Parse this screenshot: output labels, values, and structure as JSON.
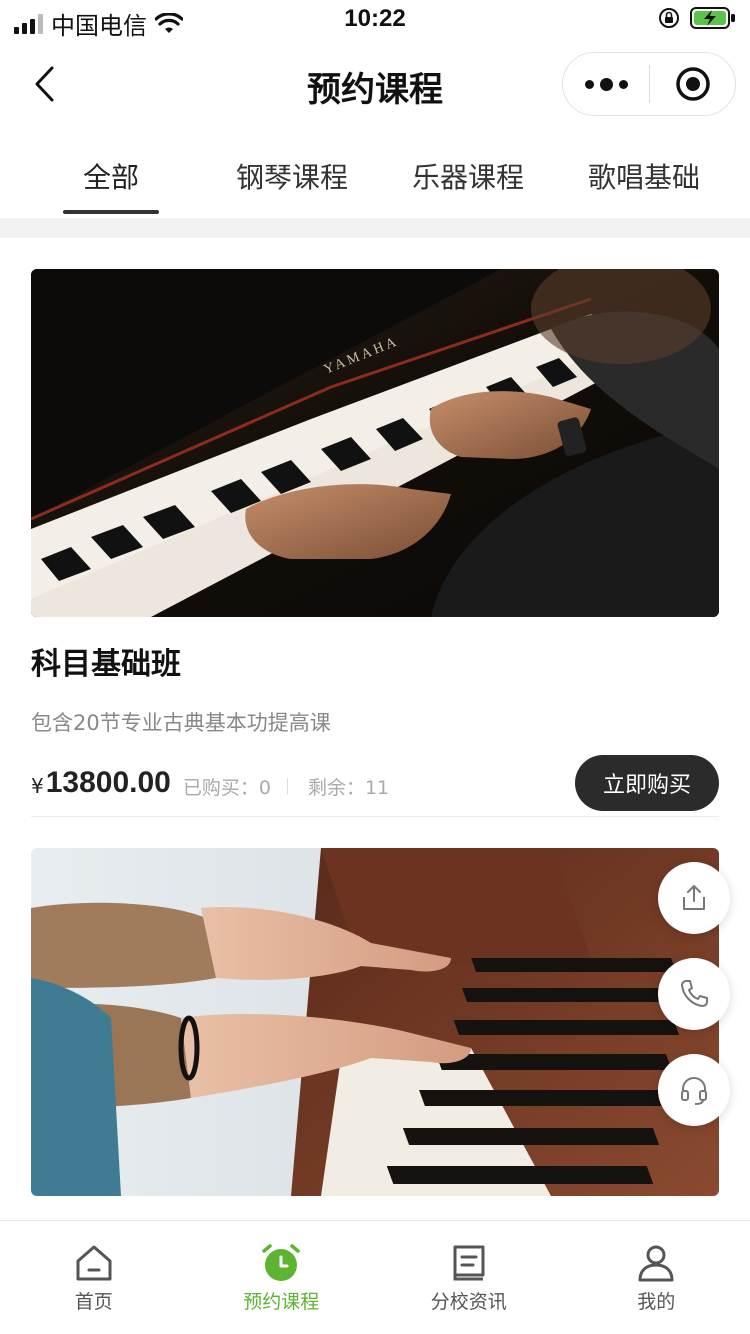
{
  "status_bar": {
    "carrier": "中国电信",
    "time": "10:22"
  },
  "nav": {
    "title": "预约课程"
  },
  "tabs": [
    {
      "label": "全部",
      "active": true
    },
    {
      "label": "钢琴课程",
      "active": false
    },
    {
      "label": "乐器课程",
      "active": false
    },
    {
      "label": "歌唱基础",
      "active": false
    }
  ],
  "courses": [
    {
      "title": "科目基础班",
      "description": "包含20节专业古典基本功提高课",
      "currency": "¥",
      "price": "13800.00",
      "purchased_label": "已购买：0",
      "remaining_label": "剩余：11",
      "buy_label": "立即购买"
    },
    {
      "title": "",
      "description": ""
    }
  ],
  "floating_buttons": [
    "share-icon",
    "phone-icon",
    "headset-icon"
  ],
  "tabbar": [
    {
      "label": "首页",
      "icon": "home-icon",
      "active": false
    },
    {
      "label": "预约课程",
      "icon": "alarm-clock-icon",
      "active": true
    },
    {
      "label": "分校资讯",
      "icon": "document-icon",
      "active": false
    },
    {
      "label": "我的",
      "icon": "user-icon",
      "active": false
    }
  ],
  "colors": {
    "accent": "#5cb431",
    "button_dark": "#2b2b2b"
  }
}
